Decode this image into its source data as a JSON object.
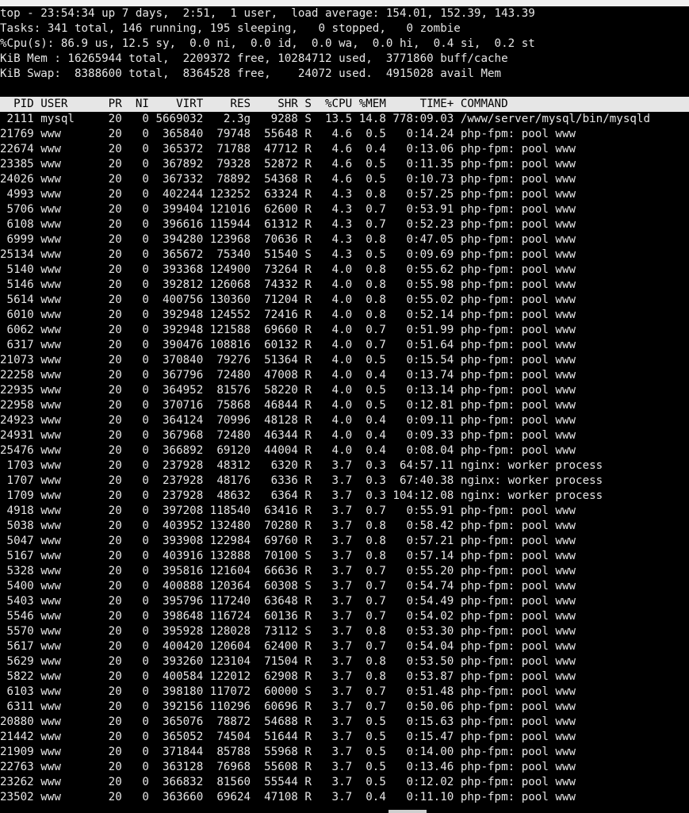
{
  "summary": [
    "top - 23:54:34 up 7 days,  2:51,  1 user,  load average: 154.01, 152.39, 143.39",
    "Tasks: 341 total, 146 running, 195 sleeping,   0 stopped,   0 zombie",
    "%Cpu(s): 86.9 us, 12.5 sy,  0.0 ni,  0.0 id,  0.0 wa,  0.0 hi,  0.4 si,  0.2 st",
    "KiB Mem : 16265944 total,  2209372 free, 10284712 used,  3771860 buff/cache",
    "KiB Swap:  8388600 total,  8364528 free,    24072 used.  4915028 avail Mem"
  ],
  "table_header": "  PID USER      PR  NI    VIRT    RES    SHR S  %CPU %MEM     TIME+ COMMAND",
  "processes": [
    {
      "pid": "2111",
      "user": "mysql",
      "pr": "20",
      "ni": "0",
      "virt": "5669032",
      "res": "2.3g",
      "shr": "9288",
      "s": "S",
      "cpu": "13.5",
      "mem": "14.8",
      "time": "778:09.03",
      "cmd": "/www/server/mysql/bin/mysqld"
    },
    {
      "pid": "21769",
      "user": "www",
      "pr": "20",
      "ni": "0",
      "virt": "365840",
      "res": "79748",
      "shr": "55648",
      "s": "R",
      "cpu": "4.6",
      "mem": "0.5",
      "time": "0:14.24",
      "cmd": "php-fpm: pool www"
    },
    {
      "pid": "22674",
      "user": "www",
      "pr": "20",
      "ni": "0",
      "virt": "365372",
      "res": "71788",
      "shr": "47712",
      "s": "R",
      "cpu": "4.6",
      "mem": "0.4",
      "time": "0:13.06",
      "cmd": "php-fpm: pool www"
    },
    {
      "pid": "23385",
      "user": "www",
      "pr": "20",
      "ni": "0",
      "virt": "367892",
      "res": "79328",
      "shr": "52872",
      "s": "R",
      "cpu": "4.6",
      "mem": "0.5",
      "time": "0:11.35",
      "cmd": "php-fpm: pool www"
    },
    {
      "pid": "24026",
      "user": "www",
      "pr": "20",
      "ni": "0",
      "virt": "367332",
      "res": "78892",
      "shr": "54368",
      "s": "R",
      "cpu": "4.6",
      "mem": "0.5",
      "time": "0:10.73",
      "cmd": "php-fpm: pool www"
    },
    {
      "pid": "4993",
      "user": "www",
      "pr": "20",
      "ni": "0",
      "virt": "402244",
      "res": "123252",
      "shr": "63324",
      "s": "R",
      "cpu": "4.3",
      "mem": "0.8",
      "time": "0:57.25",
      "cmd": "php-fpm: pool www"
    },
    {
      "pid": "5706",
      "user": "www",
      "pr": "20",
      "ni": "0",
      "virt": "399404",
      "res": "121016",
      "shr": "62600",
      "s": "R",
      "cpu": "4.3",
      "mem": "0.7",
      "time": "0:53.91",
      "cmd": "php-fpm: pool www"
    },
    {
      "pid": "6108",
      "user": "www",
      "pr": "20",
      "ni": "0",
      "virt": "396616",
      "res": "115944",
      "shr": "61312",
      "s": "R",
      "cpu": "4.3",
      "mem": "0.7",
      "time": "0:52.23",
      "cmd": "php-fpm: pool www"
    },
    {
      "pid": "6999",
      "user": "www",
      "pr": "20",
      "ni": "0",
      "virt": "394280",
      "res": "123968",
      "shr": "70636",
      "s": "R",
      "cpu": "4.3",
      "mem": "0.8",
      "time": "0:47.05",
      "cmd": "php-fpm: pool www"
    },
    {
      "pid": "25134",
      "user": "www",
      "pr": "20",
      "ni": "0",
      "virt": "365672",
      "res": "75340",
      "shr": "51540",
      "s": "S",
      "cpu": "4.3",
      "mem": "0.5",
      "time": "0:09.69",
      "cmd": "php-fpm: pool www"
    },
    {
      "pid": "5140",
      "user": "www",
      "pr": "20",
      "ni": "0",
      "virt": "393368",
      "res": "124900",
      "shr": "73264",
      "s": "R",
      "cpu": "4.0",
      "mem": "0.8",
      "time": "0:55.62",
      "cmd": "php-fpm: pool www"
    },
    {
      "pid": "5146",
      "user": "www",
      "pr": "20",
      "ni": "0",
      "virt": "392812",
      "res": "126068",
      "shr": "74332",
      "s": "R",
      "cpu": "4.0",
      "mem": "0.8",
      "time": "0:55.98",
      "cmd": "php-fpm: pool www"
    },
    {
      "pid": "5614",
      "user": "www",
      "pr": "20",
      "ni": "0",
      "virt": "400756",
      "res": "130360",
      "shr": "71204",
      "s": "R",
      "cpu": "4.0",
      "mem": "0.8",
      "time": "0:55.02",
      "cmd": "php-fpm: pool www"
    },
    {
      "pid": "6010",
      "user": "www",
      "pr": "20",
      "ni": "0",
      "virt": "392948",
      "res": "124552",
      "shr": "72416",
      "s": "R",
      "cpu": "4.0",
      "mem": "0.8",
      "time": "0:52.14",
      "cmd": "php-fpm: pool www"
    },
    {
      "pid": "6062",
      "user": "www",
      "pr": "20",
      "ni": "0",
      "virt": "392948",
      "res": "121588",
      "shr": "69660",
      "s": "R",
      "cpu": "4.0",
      "mem": "0.7",
      "time": "0:51.99",
      "cmd": "php-fpm: pool www"
    },
    {
      "pid": "6317",
      "user": "www",
      "pr": "20",
      "ni": "0",
      "virt": "390476",
      "res": "108816",
      "shr": "60132",
      "s": "R",
      "cpu": "4.0",
      "mem": "0.7",
      "time": "0:51.64",
      "cmd": "php-fpm: pool www"
    },
    {
      "pid": "21073",
      "user": "www",
      "pr": "20",
      "ni": "0",
      "virt": "370840",
      "res": "79276",
      "shr": "51364",
      "s": "R",
      "cpu": "4.0",
      "mem": "0.5",
      "time": "0:15.54",
      "cmd": "php-fpm: pool www"
    },
    {
      "pid": "22258",
      "user": "www",
      "pr": "20",
      "ni": "0",
      "virt": "367796",
      "res": "72480",
      "shr": "47008",
      "s": "R",
      "cpu": "4.0",
      "mem": "0.4",
      "time": "0:13.74",
      "cmd": "php-fpm: pool www"
    },
    {
      "pid": "22935",
      "user": "www",
      "pr": "20",
      "ni": "0",
      "virt": "364952",
      "res": "81576",
      "shr": "58220",
      "s": "R",
      "cpu": "4.0",
      "mem": "0.5",
      "time": "0:13.14",
      "cmd": "php-fpm: pool www"
    },
    {
      "pid": "22958",
      "user": "www",
      "pr": "20",
      "ni": "0",
      "virt": "370716",
      "res": "75868",
      "shr": "46844",
      "s": "R",
      "cpu": "4.0",
      "mem": "0.5",
      "time": "0:12.81",
      "cmd": "php-fpm: pool www"
    },
    {
      "pid": "24923",
      "user": "www",
      "pr": "20",
      "ni": "0",
      "virt": "364124",
      "res": "70996",
      "shr": "48128",
      "s": "R",
      "cpu": "4.0",
      "mem": "0.4",
      "time": "0:09.11",
      "cmd": "php-fpm: pool www"
    },
    {
      "pid": "24931",
      "user": "www",
      "pr": "20",
      "ni": "0",
      "virt": "367968",
      "res": "72480",
      "shr": "46344",
      "s": "R",
      "cpu": "4.0",
      "mem": "0.4",
      "time": "0:09.33",
      "cmd": "php-fpm: pool www"
    },
    {
      "pid": "25476",
      "user": "www",
      "pr": "20",
      "ni": "0",
      "virt": "366892",
      "res": "69120",
      "shr": "44004",
      "s": "R",
      "cpu": "4.0",
      "mem": "0.4",
      "time": "0:08.04",
      "cmd": "php-fpm: pool www"
    },
    {
      "pid": "1703",
      "user": "www",
      "pr": "20",
      "ni": "0",
      "virt": "237928",
      "res": "48312",
      "shr": "6320",
      "s": "R",
      "cpu": "3.7",
      "mem": "0.3",
      "time": "64:57.11",
      "cmd": "nginx: worker process"
    },
    {
      "pid": "1707",
      "user": "www",
      "pr": "20",
      "ni": "0",
      "virt": "237928",
      "res": "48176",
      "shr": "6336",
      "s": "R",
      "cpu": "3.7",
      "mem": "0.3",
      "time": "67:40.38",
      "cmd": "nginx: worker process"
    },
    {
      "pid": "1709",
      "user": "www",
      "pr": "20",
      "ni": "0",
      "virt": "237928",
      "res": "48632",
      "shr": "6364",
      "s": "R",
      "cpu": "3.7",
      "mem": "0.3",
      "time": "104:12.08",
      "cmd": "nginx: worker process"
    },
    {
      "pid": "4918",
      "user": "www",
      "pr": "20",
      "ni": "0",
      "virt": "397208",
      "res": "118540",
      "shr": "63416",
      "s": "R",
      "cpu": "3.7",
      "mem": "0.7",
      "time": "0:55.91",
      "cmd": "php-fpm: pool www"
    },
    {
      "pid": "5038",
      "user": "www",
      "pr": "20",
      "ni": "0",
      "virt": "403952",
      "res": "132480",
      "shr": "70280",
      "s": "R",
      "cpu": "3.7",
      "mem": "0.8",
      "time": "0:58.42",
      "cmd": "php-fpm: pool www"
    },
    {
      "pid": "5047",
      "user": "www",
      "pr": "20",
      "ni": "0",
      "virt": "393908",
      "res": "122984",
      "shr": "69760",
      "s": "R",
      "cpu": "3.7",
      "mem": "0.8",
      "time": "0:57.21",
      "cmd": "php-fpm: pool www"
    },
    {
      "pid": "5167",
      "user": "www",
      "pr": "20",
      "ni": "0",
      "virt": "403916",
      "res": "132888",
      "shr": "70100",
      "s": "S",
      "cpu": "3.7",
      "mem": "0.8",
      "time": "0:57.14",
      "cmd": "php-fpm: pool www"
    },
    {
      "pid": "5328",
      "user": "www",
      "pr": "20",
      "ni": "0",
      "virt": "395816",
      "res": "121604",
      "shr": "66636",
      "s": "R",
      "cpu": "3.7",
      "mem": "0.7",
      "time": "0:55.20",
      "cmd": "php-fpm: pool www"
    },
    {
      "pid": "5400",
      "user": "www",
      "pr": "20",
      "ni": "0",
      "virt": "400888",
      "res": "120364",
      "shr": "60308",
      "s": "S",
      "cpu": "3.7",
      "mem": "0.7",
      "time": "0:54.74",
      "cmd": "php-fpm: pool www"
    },
    {
      "pid": "5403",
      "user": "www",
      "pr": "20",
      "ni": "0",
      "virt": "395796",
      "res": "117240",
      "shr": "63648",
      "s": "R",
      "cpu": "3.7",
      "mem": "0.7",
      "time": "0:54.49",
      "cmd": "php-fpm: pool www"
    },
    {
      "pid": "5546",
      "user": "www",
      "pr": "20",
      "ni": "0",
      "virt": "398648",
      "res": "116724",
      "shr": "60136",
      "s": "R",
      "cpu": "3.7",
      "mem": "0.7",
      "time": "0:54.02",
      "cmd": "php-fpm: pool www"
    },
    {
      "pid": "5570",
      "user": "www",
      "pr": "20",
      "ni": "0",
      "virt": "395928",
      "res": "128028",
      "shr": "73112",
      "s": "S",
      "cpu": "3.7",
      "mem": "0.8",
      "time": "0:53.30",
      "cmd": "php-fpm: pool www"
    },
    {
      "pid": "5617",
      "user": "www",
      "pr": "20",
      "ni": "0",
      "virt": "400420",
      "res": "120604",
      "shr": "62400",
      "s": "R",
      "cpu": "3.7",
      "mem": "0.7",
      "time": "0:54.04",
      "cmd": "php-fpm: pool www"
    },
    {
      "pid": "5629",
      "user": "www",
      "pr": "20",
      "ni": "0",
      "virt": "393260",
      "res": "123104",
      "shr": "71504",
      "s": "R",
      "cpu": "3.7",
      "mem": "0.8",
      "time": "0:53.50",
      "cmd": "php-fpm: pool www"
    },
    {
      "pid": "5822",
      "user": "www",
      "pr": "20",
      "ni": "0",
      "virt": "400584",
      "res": "122012",
      "shr": "62908",
      "s": "R",
      "cpu": "3.7",
      "mem": "0.8",
      "time": "0:53.87",
      "cmd": "php-fpm: pool www"
    },
    {
      "pid": "6103",
      "user": "www",
      "pr": "20",
      "ni": "0",
      "virt": "398180",
      "res": "117072",
      "shr": "60000",
      "s": "S",
      "cpu": "3.7",
      "mem": "0.7",
      "time": "0:51.48",
      "cmd": "php-fpm: pool www"
    },
    {
      "pid": "6311",
      "user": "www",
      "pr": "20",
      "ni": "0",
      "virt": "392156",
      "res": "110296",
      "shr": "60696",
      "s": "R",
      "cpu": "3.7",
      "mem": "0.7",
      "time": "0:50.06",
      "cmd": "php-fpm: pool www"
    },
    {
      "pid": "20880",
      "user": "www",
      "pr": "20",
      "ni": "0",
      "virt": "365076",
      "res": "78872",
      "shr": "54688",
      "s": "R",
      "cpu": "3.7",
      "mem": "0.5",
      "time": "0:15.63",
      "cmd": "php-fpm: pool www"
    },
    {
      "pid": "21442",
      "user": "www",
      "pr": "20",
      "ni": "0",
      "virt": "365052",
      "res": "74504",
      "shr": "51644",
      "s": "R",
      "cpu": "3.7",
      "mem": "0.5",
      "time": "0:15.47",
      "cmd": "php-fpm: pool www"
    },
    {
      "pid": "21909",
      "user": "www",
      "pr": "20",
      "ni": "0",
      "virt": "371844",
      "res": "85788",
      "shr": "55968",
      "s": "R",
      "cpu": "3.7",
      "mem": "0.5",
      "time": "0:14.00",
      "cmd": "php-fpm: pool www"
    },
    {
      "pid": "22763",
      "user": "www",
      "pr": "20",
      "ni": "0",
      "virt": "363128",
      "res": "76968",
      "shr": "55608",
      "s": "R",
      "cpu": "3.7",
      "mem": "0.5",
      "time": "0:13.46",
      "cmd": "php-fpm: pool www"
    },
    {
      "pid": "23262",
      "user": "www",
      "pr": "20",
      "ni": "0",
      "virt": "366832",
      "res": "81560",
      "shr": "55544",
      "s": "R",
      "cpu": "3.7",
      "mem": "0.5",
      "time": "0:12.02",
      "cmd": "php-fpm: pool www"
    },
    {
      "pid": "23502",
      "user": "www",
      "pr": "20",
      "ni": "0",
      "virt": "363660",
      "res": "69624",
      "shr": "47108",
      "s": "R",
      "cpu": "3.7",
      "mem": "0.4",
      "time": "0:11.10",
      "cmd": "php-fpm: pool www"
    }
  ]
}
